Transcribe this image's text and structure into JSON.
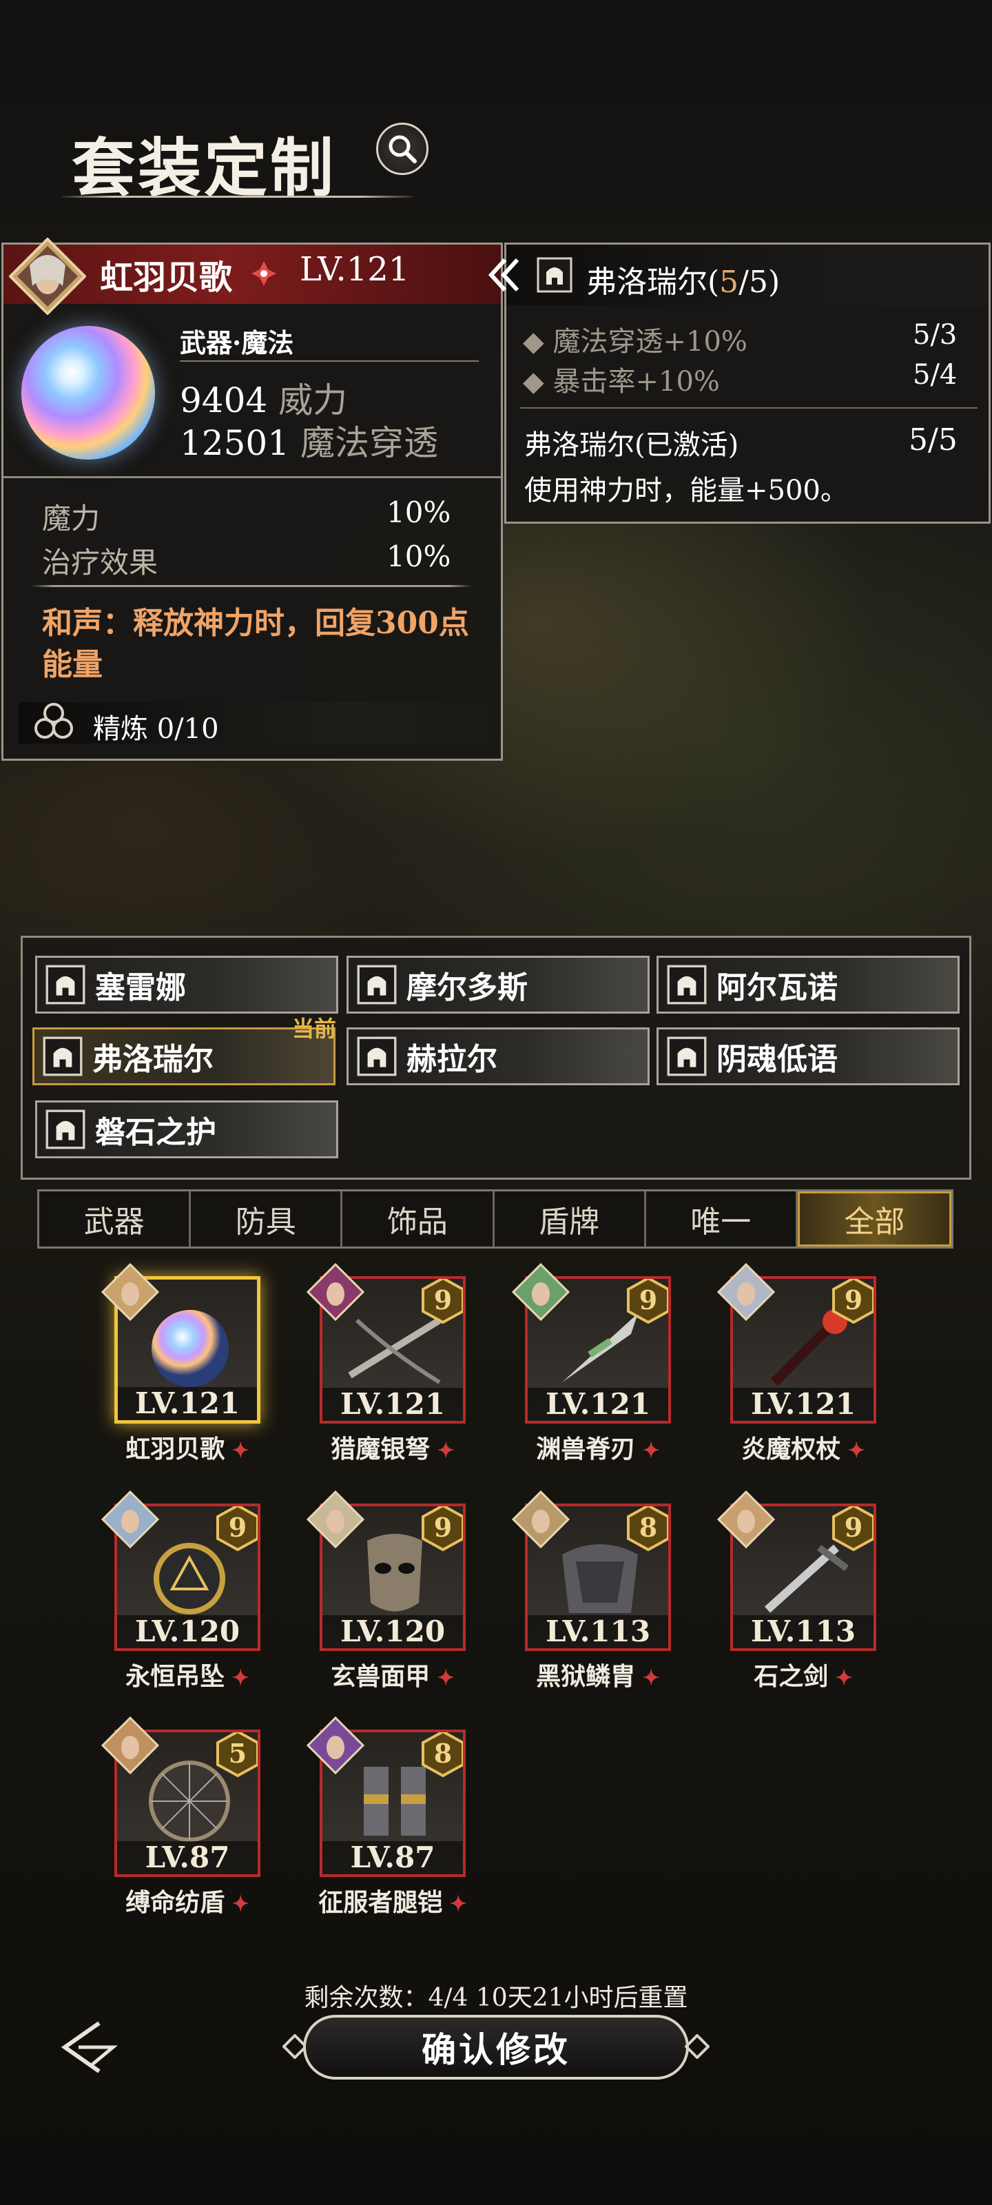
{
  "header": {
    "title": "套装定制"
  },
  "item": {
    "hero_name": "虹羽贝歌",
    "level": "LV.121",
    "type": "武器·魔法",
    "stat1_value": "9404",
    "stat1_label": "威力",
    "stat2_value": "12501",
    "stat2_label": "魔法穿透",
    "subs": [
      {
        "name": "魔力",
        "value": "10%"
      },
      {
        "name": "治疗效果",
        "value": "10%"
      }
    ],
    "harmony": "和声：释放神力时，回复300点能量",
    "refine": "精炼 0/10"
  },
  "set_bonus": {
    "title_prefix": "弗洛瑞尔(",
    "title_count": "5",
    "title_suffix": "/5)",
    "lines": [
      {
        "text": "◆ 魔法穿透+10%",
        "value": "5/3"
      },
      {
        "text": "◆ 暴击率+10%",
        "value": "5/4"
      }
    ],
    "active_name": "弗洛瑞尔(已激活)",
    "active_value": "5/5",
    "active_desc": "使用神力时，能量+500。",
    "count_color": "#e8a96a"
  },
  "sets": [
    {
      "label": "塞雷娜"
    },
    {
      "label": "摩尔多斯"
    },
    {
      "label": "阿尔瓦诺"
    },
    {
      "label": "弗洛瑞尔",
      "current": "当前"
    },
    {
      "label": "赫拉尔"
    },
    {
      "label": "阴魂低语"
    },
    {
      "label": "磐石之护"
    }
  ],
  "tabs": [
    "武器",
    "防具",
    "饰品",
    "盾牌",
    "唯一",
    "全部"
  ],
  "active_tab": "全部",
  "equipment": [
    {
      "name": "虹羽贝歌",
      "level": "LV.121",
      "badge": "",
      "art": "orb"
    },
    {
      "name": "猎魔银弩",
      "level": "LV.121",
      "badge": "9",
      "art": "crossbow"
    },
    {
      "name": "渊兽脊刃",
      "level": "LV.121",
      "badge": "9",
      "art": "blade"
    },
    {
      "name": "炎魔权杖",
      "level": "LV.121",
      "badge": "9",
      "art": "scepter"
    },
    {
      "name": "永恒吊坠",
      "level": "LV.120",
      "badge": "9",
      "art": "pendant"
    },
    {
      "name": "玄兽面甲",
      "level": "LV.120",
      "badge": "9",
      "art": "mask"
    },
    {
      "name": "黑狱鳞胄",
      "level": "LV.113",
      "badge": "8",
      "art": "armor"
    },
    {
      "name": "石之剑",
      "level": "LV.113",
      "badge": "9",
      "art": "sword"
    },
    {
      "name": "缚命纺盾",
      "level": "LV.87",
      "badge": "5",
      "art": "shield"
    },
    {
      "name": "征服者腿铠",
      "level": "LV.87",
      "badge": "8",
      "art": "greaves"
    }
  ],
  "footer": {
    "remaining": "剩余次数：4/4   10天21小时后重置",
    "confirm": "确认修改"
  },
  "colors": {
    "accent_gold": "#e4b74c",
    "rarity_red": "#b82a2a",
    "harmony_orange": "#f0a468"
  }
}
